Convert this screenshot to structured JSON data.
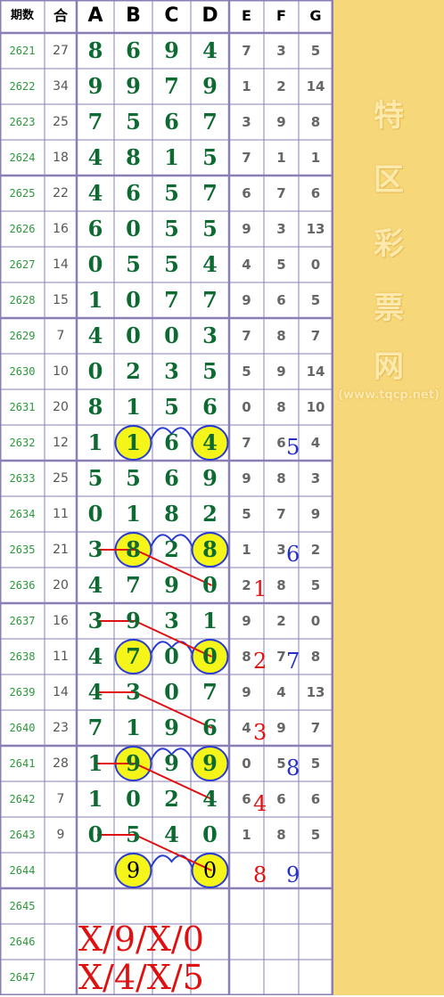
{
  "header": {
    "issue": "期数",
    "sum": "合",
    "cols_main": [
      "A",
      "B",
      "C",
      "D"
    ],
    "cols_extra": [
      "E",
      "F",
      "G"
    ]
  },
  "rows": [
    {
      "issue": "2621",
      "sum": "27",
      "main": [
        "8",
        "6",
        "9",
        "4"
      ],
      "extra": [
        "7",
        "3",
        "5"
      ]
    },
    {
      "issue": "2622",
      "sum": "34",
      "main": [
        "9",
        "9",
        "7",
        "9"
      ],
      "extra": [
        "1",
        "2",
        "14"
      ]
    },
    {
      "issue": "2623",
      "sum": "25",
      "main": [
        "7",
        "5",
        "6",
        "7"
      ],
      "extra": [
        "3",
        "9",
        "8"
      ]
    },
    {
      "issue": "2624",
      "sum": "18",
      "main": [
        "4",
        "8",
        "1",
        "5"
      ],
      "extra": [
        "7",
        "1",
        "1"
      ]
    },
    {
      "issue": "2625",
      "sum": "22",
      "main": [
        "4",
        "6",
        "5",
        "7"
      ],
      "extra": [
        "6",
        "7",
        "6"
      ]
    },
    {
      "issue": "2626",
      "sum": "16",
      "main": [
        "6",
        "0",
        "5",
        "5"
      ],
      "extra": [
        "9",
        "3",
        "13"
      ]
    },
    {
      "issue": "2627",
      "sum": "14",
      "main": [
        "0",
        "5",
        "5",
        "4"
      ],
      "extra": [
        "4",
        "5",
        "0"
      ]
    },
    {
      "issue": "2628",
      "sum": "15",
      "main": [
        "1",
        "0",
        "7",
        "7"
      ],
      "extra": [
        "9",
        "6",
        "5"
      ]
    },
    {
      "issue": "2629",
      "sum": "7",
      "main": [
        "4",
        "0",
        "0",
        "3"
      ],
      "extra": [
        "7",
        "8",
        "7"
      ]
    },
    {
      "issue": "2630",
      "sum": "10",
      "main": [
        "0",
        "2",
        "3",
        "5"
      ],
      "extra": [
        "5",
        "9",
        "14"
      ]
    },
    {
      "issue": "2631",
      "sum": "20",
      "main": [
        "8",
        "1",
        "5",
        "6"
      ],
      "extra": [
        "0",
        "8",
        "10"
      ]
    },
    {
      "issue": "2632",
      "sum": "12",
      "main": [
        "1",
        "1",
        "6",
        "4"
      ],
      "extra": [
        "7",
        "6",
        "4"
      ]
    },
    {
      "issue": "2633",
      "sum": "25",
      "main": [
        "5",
        "5",
        "6",
        "9"
      ],
      "extra": [
        "9",
        "8",
        "3"
      ]
    },
    {
      "issue": "2634",
      "sum": "11",
      "main": [
        "0",
        "1",
        "8",
        "2"
      ],
      "extra": [
        "5",
        "7",
        "9"
      ]
    },
    {
      "issue": "2635",
      "sum": "21",
      "main": [
        "3",
        "8",
        "2",
        "8"
      ],
      "extra": [
        "1",
        "3",
        "2"
      ]
    },
    {
      "issue": "2636",
      "sum": "20",
      "main": [
        "4",
        "7",
        "9",
        "0"
      ],
      "extra": [
        "2",
        "8",
        "5"
      ]
    },
    {
      "issue": "2637",
      "sum": "16",
      "main": [
        "3",
        "9",
        "3",
        "1"
      ],
      "extra": [
        "9",
        "2",
        "0"
      ]
    },
    {
      "issue": "2638",
      "sum": "11",
      "main": [
        "4",
        "7",
        "0",
        "0"
      ],
      "extra": [
        "8",
        "7",
        "8"
      ]
    },
    {
      "issue": "2639",
      "sum": "14",
      "main": [
        "4",
        "3",
        "0",
        "7"
      ],
      "extra": [
        "9",
        "4",
        "13"
      ]
    },
    {
      "issue": "2640",
      "sum": "23",
      "main": [
        "7",
        "1",
        "9",
        "6"
      ],
      "extra": [
        "4",
        "9",
        "7"
      ]
    },
    {
      "issue": "2641",
      "sum": "28",
      "main": [
        "1",
        "9",
        "9",
        "9"
      ],
      "extra": [
        "0",
        "5",
        "5"
      ]
    },
    {
      "issue": "2642",
      "sum": "7",
      "main": [
        "1",
        "0",
        "2",
        "4"
      ],
      "extra": [
        "6",
        "6",
        "6"
      ]
    },
    {
      "issue": "2643",
      "sum": "9",
      "main": [
        "0",
        "5",
        "4",
        "0"
      ],
      "extra": [
        "1",
        "8",
        "5"
      ]
    },
    {
      "issue": "2644",
      "sum": "",
      "main": [
        "",
        "9",
        "",
        "0"
      ],
      "extra": [
        "",
        "",
        ""
      ]
    },
    {
      "issue": "2645",
      "sum": "",
      "main": [
        "",
        "",
        "",
        ""
      ],
      "extra": [
        "",
        "",
        ""
      ]
    },
    {
      "issue": "2646",
      "sum": "",
      "main": [
        "",
        "",
        "",
        ""
      ],
      "extra": [
        "",
        "",
        ""
      ]
    },
    {
      "issue": "2647",
      "sum": "",
      "main": [
        "",
        "",
        "",
        ""
      ],
      "extra": [
        "",
        "",
        ""
      ]
    }
  ],
  "highlights": [
    {
      "row": 11,
      "col": 1
    },
    {
      "row": 11,
      "col": 3
    },
    {
      "row": 14,
      "col": 1
    },
    {
      "row": 14,
      "col": 3
    },
    {
      "row": 17,
      "col": 1
    },
    {
      "row": 17,
      "col": 3
    },
    {
      "row": 20,
      "col": 1
    },
    {
      "row": 20,
      "col": 3
    },
    {
      "row": 23,
      "col": 1
    },
    {
      "row": 23,
      "col": 3
    }
  ],
  "annotations": {
    "period_numbers": [
      "1",
      "2",
      "3",
      "4"
    ],
    "period_numbers_blue": [
      "5",
      "6",
      "7",
      "8"
    ],
    "extra_red": "8",
    "extra_blue": "9"
  },
  "predictions": [
    "X/9/X/0",
    "X/4/X/5"
  ],
  "sidebar": {
    "title_chars": [
      "特",
      "区",
      "彩",
      "票",
      "网"
    ],
    "url": "(www.tqcp.net)"
  },
  "colors": {
    "grid_line": "#8a7fb5",
    "main_digit": "#0d6b32",
    "issue_text": "#2a9a3a",
    "highlight_fill": "#f5f51a",
    "highlight_stroke": "#2a3cd0",
    "red": "#e01010",
    "blue": "#2430c8",
    "sidebar_bg": "#f6d77a"
  }
}
